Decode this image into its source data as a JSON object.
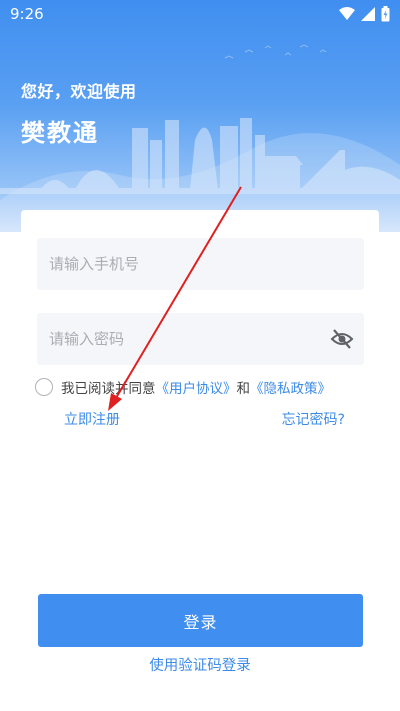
{
  "status_bar": {
    "time": "9:26"
  },
  "header": {
    "greeting": "您好，欢迎使用",
    "app_title": "樊教通"
  },
  "form": {
    "phone_placeholder": "请输入手机号",
    "password_placeholder": "请输入密码",
    "agree_prefix": "我已阅读并同意",
    "user_agreement": "《用户协议》",
    "agree_and": "和",
    "privacy_policy": "《隐私政策》",
    "register": "立即注册",
    "forgot_password": "忘记密码?",
    "login_button": "登录",
    "sms_login": "使用验证码登录"
  },
  "icons": {
    "password_toggle": "eye-off-icon",
    "wifi": "wifi-icon",
    "signal": "signal-icon",
    "battery": "battery-icon"
  },
  "colors": {
    "accent": "#3f8ef0",
    "link": "#3d8be8",
    "annotation_arrow": "#e02020"
  }
}
